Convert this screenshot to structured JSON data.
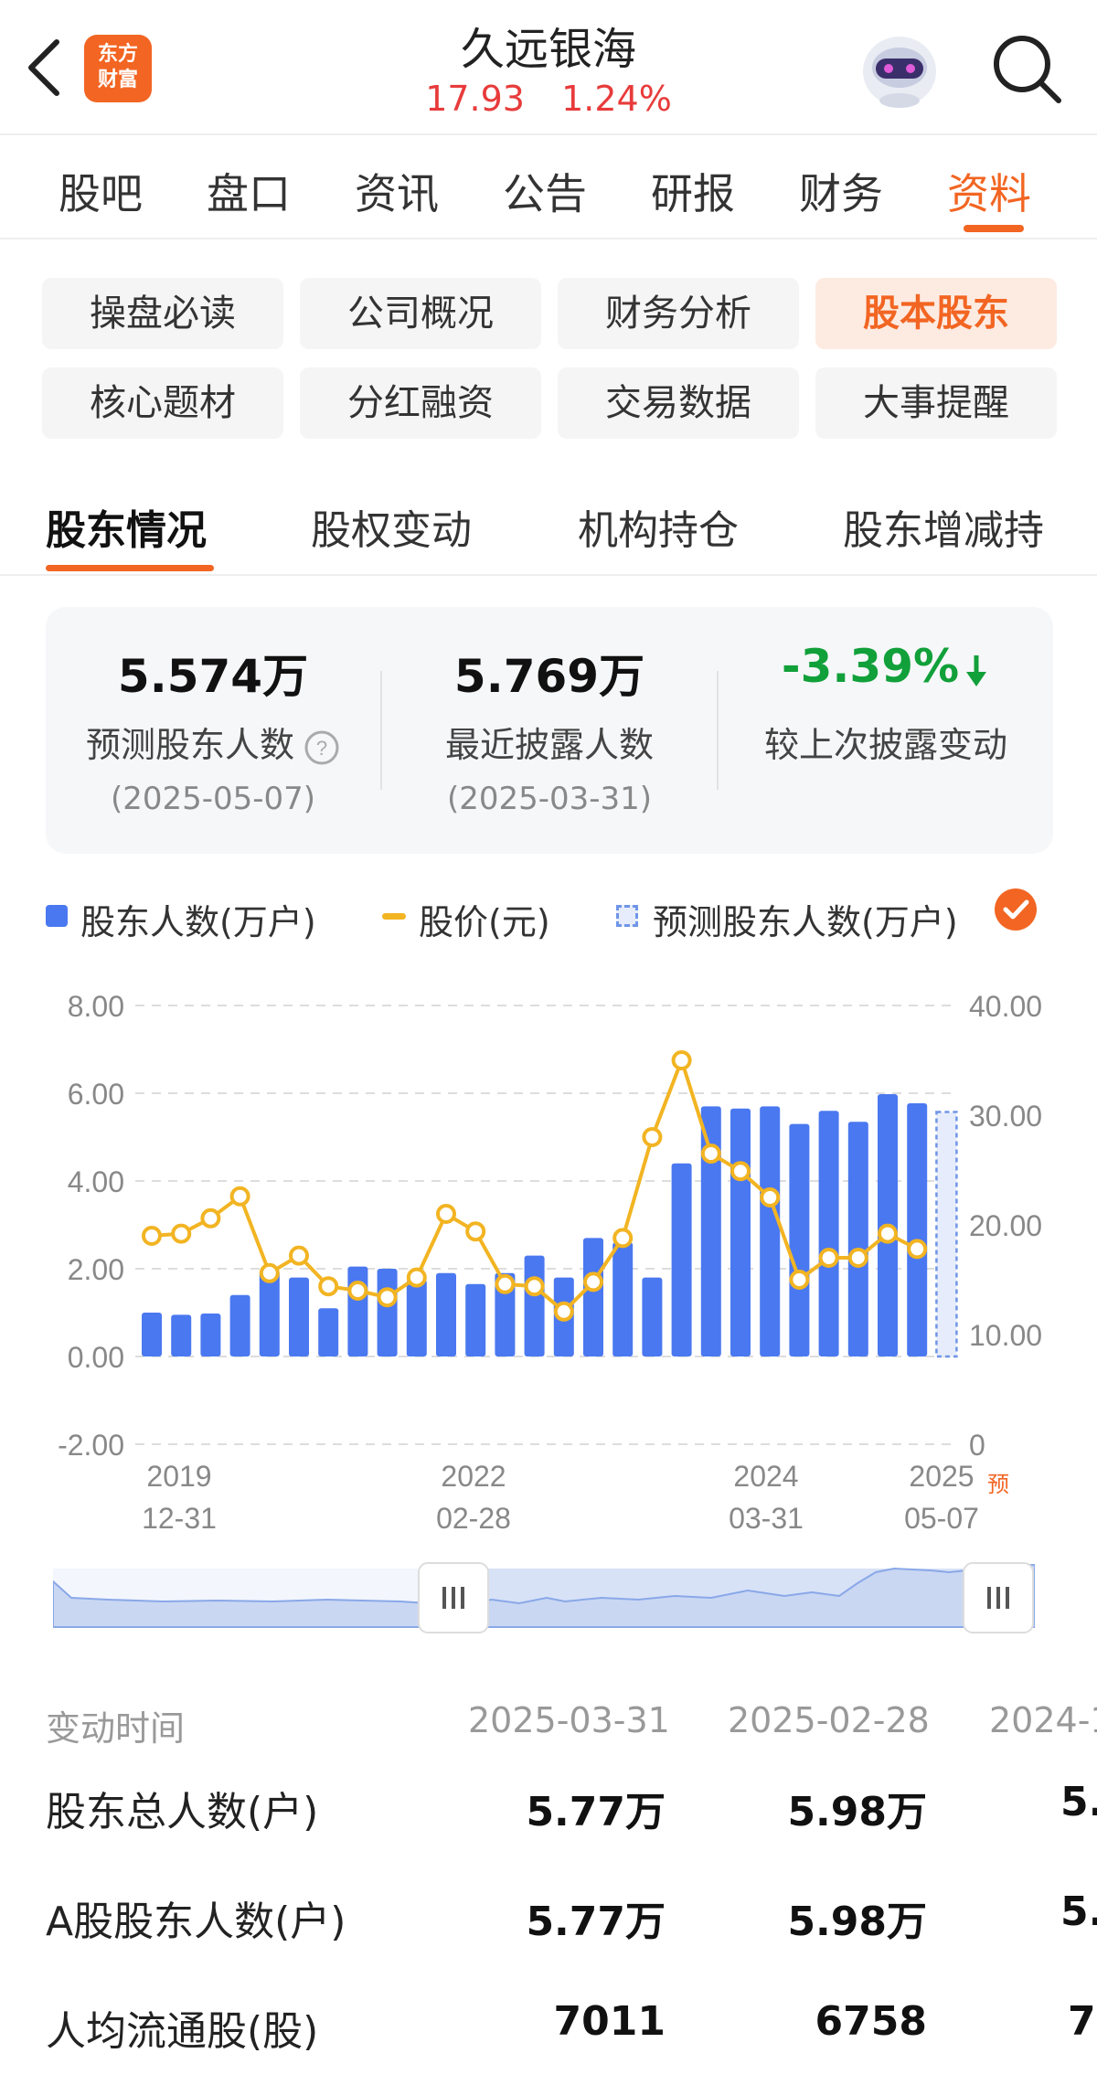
{
  "header": {
    "logo_line1": "东方",
    "logo_line2": "财富",
    "stock_name": "久远银海",
    "price": "17.93",
    "change_pct": "1.24%"
  },
  "main_tabs": [
    "股吧",
    "盘口",
    "资讯",
    "公告",
    "研报",
    "财务",
    "资料"
  ],
  "chips": [
    "操盘必读",
    "公司概况",
    "财务分析",
    "股本股东",
    "核心题材",
    "分红融资",
    "交易数据",
    "大事提醒"
  ],
  "sub_tabs": [
    "股东情况",
    "股权变动",
    "机构持仓",
    "股东增减持"
  ],
  "summary": {
    "predicted": {
      "value": "5.574万",
      "label": "预测股东人数",
      "date": "(2025-05-07)"
    },
    "latest": {
      "value": "5.769万",
      "label": "最近披露人数",
      "date": "(2025-03-31)"
    },
    "change": {
      "value": "-3.39%",
      "label": "较上次披露变动"
    }
  },
  "legend": {
    "holders": "股东人数(万户)",
    "price": "股价(元)",
    "predicted": "预测股东人数(万户)"
  },
  "chart_data": {
    "type": "bar",
    "left_axis": {
      "ticks": [
        "8.00",
        "6.00",
        "4.00",
        "2.00",
        "0.00",
        "-2.00"
      ],
      "ylim": [
        -2,
        8
      ]
    },
    "right_axis": {
      "ticks": [
        "40.00",
        "30.00",
        "20.00",
        "10.00",
        "0"
      ],
      "ylim": [
        0,
        40
      ]
    },
    "x_ticks": [
      {
        "line1": "2019",
        "line2": "12-31"
      },
      {
        "line1": "2022",
        "line2": "02-28"
      },
      {
        "line1": "2024",
        "line2": "03-31"
      },
      {
        "line1": "2025",
        "line2": "05-07"
      }
    ],
    "predicted_marker": "预",
    "series": [
      {
        "name": "股东人数(万户)",
        "kind": "bar",
        "color": "#4a78f0",
        "values": [
          1.0,
          0.95,
          0.98,
          1.4,
          1.95,
          1.8,
          1.1,
          2.05,
          2.0,
          1.75,
          1.9,
          1.65,
          1.9,
          2.3,
          1.8,
          2.7,
          2.6,
          1.8,
          4.4,
          5.7,
          5.65,
          5.7,
          5.3,
          5.6,
          5.35,
          5.98,
          5.77
        ]
      },
      {
        "name": "股价(元)",
        "kind": "line",
        "color": "#f2b422",
        "values": [
          19.0,
          19.2,
          20.6,
          22.6,
          15.6,
          17.2,
          14.4,
          14.0,
          13.4,
          15.2,
          21.0,
          19.4,
          14.6,
          14.4,
          12.1,
          14.8,
          18.8,
          28.0,
          35.0,
          26.5,
          24.9,
          22.5,
          15.0,
          17.0,
          17.0,
          19.2,
          17.8
        ]
      },
      {
        "name": "预测股东人数(万户)",
        "kind": "predicted-bar",
        "color": "#6f95e8",
        "values": [
          5.574
        ]
      }
    ]
  },
  "table": {
    "header": [
      "变动时间",
      "2025-03-31",
      "2025-02-28",
      "2024-1"
    ],
    "rows": [
      {
        "label": "股东总人数(户)",
        "values": [
          "5.77万",
          "5.98万",
          "5."
        ]
      },
      {
        "label": "A股股东人数(户)",
        "values": [
          "5.77万",
          "5.98万",
          "5."
        ]
      },
      {
        "label": "人均流通股(股)",
        "values": [
          "7011",
          "6758",
          "7"
        ]
      }
    ]
  }
}
